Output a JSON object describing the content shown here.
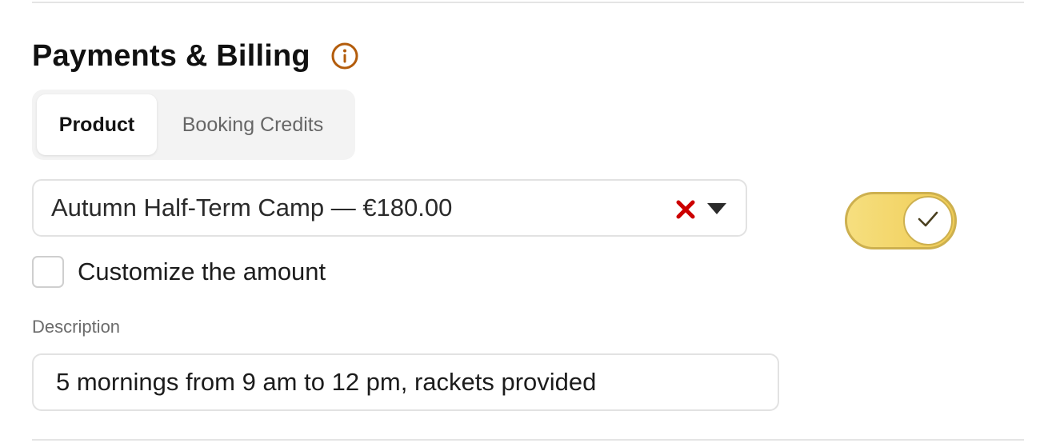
{
  "section": {
    "title": "Payments & Billing",
    "info_icon": "info-circle-icon",
    "accent_color": "#b35c0b"
  },
  "tabs": [
    {
      "label": "Product",
      "active": true
    },
    {
      "label": "Booking Credits",
      "active": false
    }
  ],
  "product_select": {
    "value": "Autumn Half-Term Camp — €180.00",
    "clear_icon": "close-x-icon",
    "clear_color": "#cc0000",
    "dropdown_icon": "caret-down-icon"
  },
  "toggle": {
    "on": true,
    "knob_icon": "check-icon",
    "color": "#f0cc55"
  },
  "customize_amount": {
    "label": "Customize the amount",
    "checked": false
  },
  "description": {
    "label": "Description",
    "value": "5 mornings from 9 am to 12 pm, rackets provided"
  }
}
